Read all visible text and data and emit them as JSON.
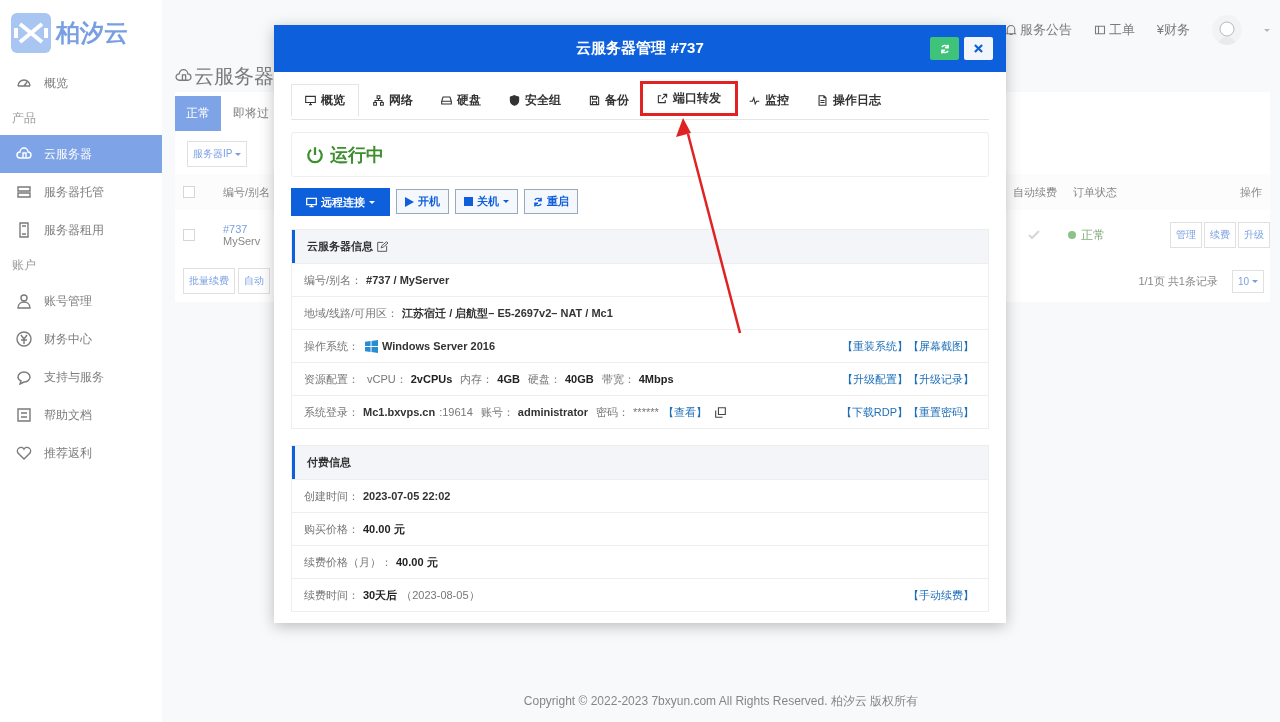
{
  "sidebar": {
    "logo_text": "柏汐云",
    "items": [
      {
        "kind": "link",
        "label": "概览",
        "selected": false
      },
      {
        "kind": "section",
        "label": "产品"
      },
      {
        "kind": "link",
        "label": "云服务器",
        "selected": true
      },
      {
        "kind": "link",
        "label": "服务器托管",
        "selected": false
      },
      {
        "kind": "link",
        "label": "服务器租用",
        "selected": false
      },
      {
        "kind": "section",
        "label": "账户"
      },
      {
        "kind": "link",
        "label": "账号管理",
        "selected": false
      },
      {
        "kind": "link",
        "label": "财务中心",
        "selected": false
      },
      {
        "kind": "link",
        "label": "支持与服务",
        "selected": false
      },
      {
        "kind": "link",
        "label": "帮助文档",
        "selected": false
      },
      {
        "kind": "link",
        "label": "推荐返利",
        "selected": false
      }
    ]
  },
  "header": {
    "links": [
      {
        "label": "服务公告"
      },
      {
        "label": "工单"
      },
      {
        "label": "¥财务"
      }
    ]
  },
  "page": {
    "title": "云服务器",
    "tabs": [
      {
        "label": "正常",
        "selected": true
      },
      {
        "label": "即将过",
        "selected": false
      }
    ],
    "filter": "服务器IP",
    "table": {
      "select_all": {
        "checked": false
      },
      "columns_left": [
        "编号/别名"
      ],
      "columns_right": [
        "自动续费",
        "订单状态",
        "操作"
      ],
      "row": {
        "checked": false,
        "id": "#737",
        "alias": "MyServ",
        "auto_renew": true,
        "status": "正常",
        "actions": [
          "管理",
          "续费",
          "升级"
        ]
      }
    },
    "bulk_buttons": [
      "批量续费",
      "自动"
    ],
    "pagination": {
      "summary": "1/1页 共1条记录",
      "page_size": "10"
    }
  },
  "modal": {
    "title": "云服务器管理 #737",
    "tabs": [
      {
        "label": "概览",
        "selected": true,
        "highlighted": false
      },
      {
        "label": "网络",
        "selected": false,
        "highlighted": false
      },
      {
        "label": "硬盘",
        "selected": false,
        "highlighted": false
      },
      {
        "label": "安全组",
        "selected": false,
        "highlighted": false
      },
      {
        "label": "备份",
        "selected": false,
        "highlighted": false
      },
      {
        "label": "端口转发",
        "selected": false,
        "highlighted": true
      },
      {
        "label": "监控",
        "selected": false,
        "highlighted": false
      },
      {
        "label": "操作日志",
        "selected": false,
        "highlighted": false
      }
    ],
    "status": {
      "label": "运行中",
      "running": true
    },
    "actions": [
      {
        "label": "远程连接",
        "kind": "primary",
        "dropdown": true
      },
      {
        "label": "开机",
        "kind": "start",
        "dropdown": false
      },
      {
        "label": "关机",
        "kind": "stop",
        "dropdown": true
      },
      {
        "label": "重启",
        "kind": "restart",
        "dropdown": false
      }
    ],
    "sections": [
      {
        "title": "云服务器信息",
        "editable": true,
        "rows": [
          {
            "label": "编号/别名：",
            "parts": [
              {
                "kind": "value",
                "text": "#737 / MyServer"
              }
            ],
            "actions": []
          },
          {
            "label": "地域/线路/可用区：",
            "parts": [
              {
                "kind": "value",
                "text": "江苏宿迁 / 启航型– E5-2697v2– NAT / Mc1"
              }
            ],
            "actions": []
          },
          {
            "label": "操作系统：",
            "parts": [
              {
                "kind": "os_icon"
              },
              {
                "kind": "value",
                "text": "Windows Server 2016"
              }
            ],
            "actions": [
              "【重装系统】",
              "【屏幕截图】"
            ]
          },
          {
            "label": "资源配置：",
            "parts": [
              {
                "kind": "label",
                "text": "vCPU："
              },
              {
                "kind": "strong",
                "text": "2vCPUs"
              },
              {
                "kind": "label",
                "text": "内存："
              },
              {
                "kind": "strong",
                "text": "4GB"
              },
              {
                "kind": "label",
                "text": "硬盘："
              },
              {
                "kind": "strong",
                "text": "40GB"
              },
              {
                "kind": "label",
                "text": "带宽："
              },
              {
                "kind": "strong",
                "text": "4Mbps"
              }
            ],
            "actions": [
              "【升级配置】",
              "【升级记录】"
            ]
          },
          {
            "label": "系统登录：",
            "parts": [
              {
                "kind": "value",
                "text": "Mc1.bxvps.cn"
              },
              {
                "kind": "muted",
                "text": ":19614"
              },
              {
                "kind": "label",
                "text": "账号："
              },
              {
                "kind": "value",
                "text": "administrator"
              },
              {
                "kind": "label",
                "text": "密码："
              },
              {
                "kind": "muted",
                "text": "******"
              },
              {
                "kind": "link",
                "text": "【查看】"
              },
              {
                "kind": "copy_icon"
              }
            ],
            "actions": [
              "【下载RDP】",
              "【重置密码】"
            ]
          }
        ]
      },
      {
        "title": "付费信息",
        "editable": false,
        "rows": [
          {
            "label": "创建时间：",
            "parts": [
              {
                "kind": "value",
                "text": "2023-07-05 22:02"
              }
            ],
            "actions": []
          },
          {
            "label": "购买价格：",
            "parts": [
              {
                "kind": "strong",
                "text": "40.00 元"
              }
            ],
            "actions": []
          },
          {
            "label": "续费价格（月）：",
            "parts": [
              {
                "kind": "strong",
                "text": "40.00 元"
              }
            ],
            "actions": []
          },
          {
            "label": "续费时间：",
            "parts": [
              {
                "kind": "strong",
                "text": "30天后"
              },
              {
                "kind": "muted",
                "text": "（2023-08-05）"
              }
            ],
            "actions": [
              "【手动续费】"
            ]
          }
        ]
      }
    ]
  },
  "footer": "Copyright © 2022-2023 7bxyun.com All Rights Reserved. 柏汐云 版权所有"
}
